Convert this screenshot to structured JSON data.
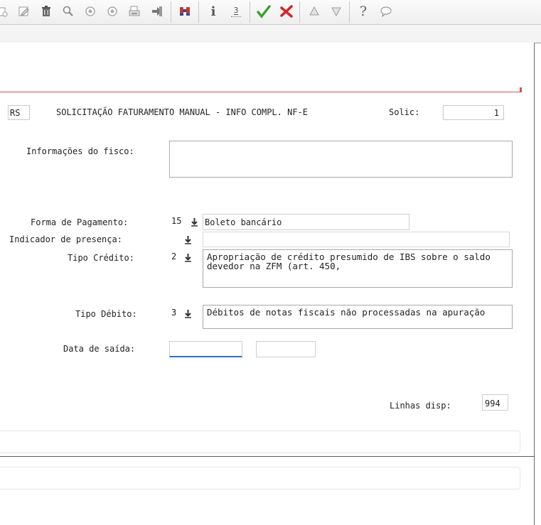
{
  "toolbar": {
    "buttons": [
      {
        "name": "copy-icon"
      },
      {
        "name": "edit-icon"
      },
      {
        "name": "delete-icon"
      },
      {
        "name": "search-icon"
      },
      {
        "name": "previous-record-icon"
      },
      {
        "name": "next-record-icon"
      },
      {
        "name": "print-icon"
      },
      {
        "name": "go-to-icon"
      },
      {
        "name": "zoom-binoculars-icon"
      },
      {
        "name": "info-icon"
      },
      {
        "name": "sequence-icon"
      },
      {
        "name": "confirm-check-icon"
      },
      {
        "name": "cancel-x-icon"
      },
      {
        "name": "move-up-icon"
      },
      {
        "name": "move-down-icon"
      },
      {
        "name": "help-icon"
      },
      {
        "name": "chat-icon"
      }
    ],
    "info_glyph": "i",
    "sequence_glyph": "3",
    "help_glyph": "?"
  },
  "header": {
    "estab": "RS",
    "title": "SOLICITAÇÃO FATURAMENTO MANUAL - INFO COMPL. NF-E",
    "solic_label": "Solic:",
    "solic_value": "1"
  },
  "form": {
    "fisco_label": "Informações do fisco:",
    "fisco_value": "",
    "pagamento_label": "Forma de Pagamento:",
    "pagamento_code": "15",
    "pagamento_desc": "Boleto bancário",
    "presenca_label": "Indicador de presença:",
    "presenca_code": "",
    "presenca_desc": "",
    "credito_label": "Tipo Crédito:",
    "credito_code": "2",
    "credito_desc": "Apropriação de crédito presumido de IBS sobre o saldo devedor na ZFM (art. 450,",
    "debito_label": "Tipo Débito:",
    "debito_code": "3",
    "debito_desc": "Débitos de notas fiscais não processadas na apuração",
    "data_label": "Data de saída:",
    "data_value": "",
    "data_extra": "",
    "linhas_label": "Linhas disp:",
    "linhas_value": "994"
  },
  "colors": {
    "accent_red": "#d9534f",
    "focus_blue": "#2a6fd1",
    "check_green": "#3aa12b",
    "cancel_red": "#d0282d"
  }
}
